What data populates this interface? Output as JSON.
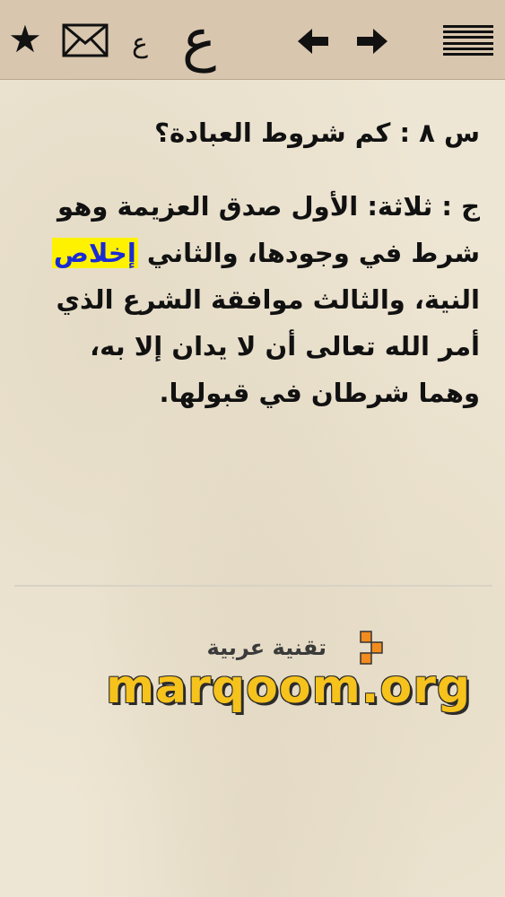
{
  "toolbar": {
    "star_glyph": "★",
    "ain_small": "ع",
    "ain_large": "ع"
  },
  "content": {
    "question": "س ٨ : كم شروط العبادة؟",
    "answer_before": "ج : ثلاثة: الأول صدق العزيمة وهو شرط في وجودها، والثاني ",
    "answer_highlight": "إخلاص",
    "answer_after": " النية، والثالث موافقة الشرع الذي أمر الله تعالى أن لا يدان إلا به، وهما شرطان في قبولها."
  },
  "logo": {
    "arabic": "تقنية عربية",
    "site": "marqoom.org"
  },
  "colors": {
    "toolbar_bg": "#d8c6ae",
    "paper_bg": "#eee6d4",
    "highlight_bg": "#fff200",
    "highlight_text": "#1a2bd6",
    "logo_yellow": "#f6c21c",
    "logo_orange": "#f28c1e"
  }
}
